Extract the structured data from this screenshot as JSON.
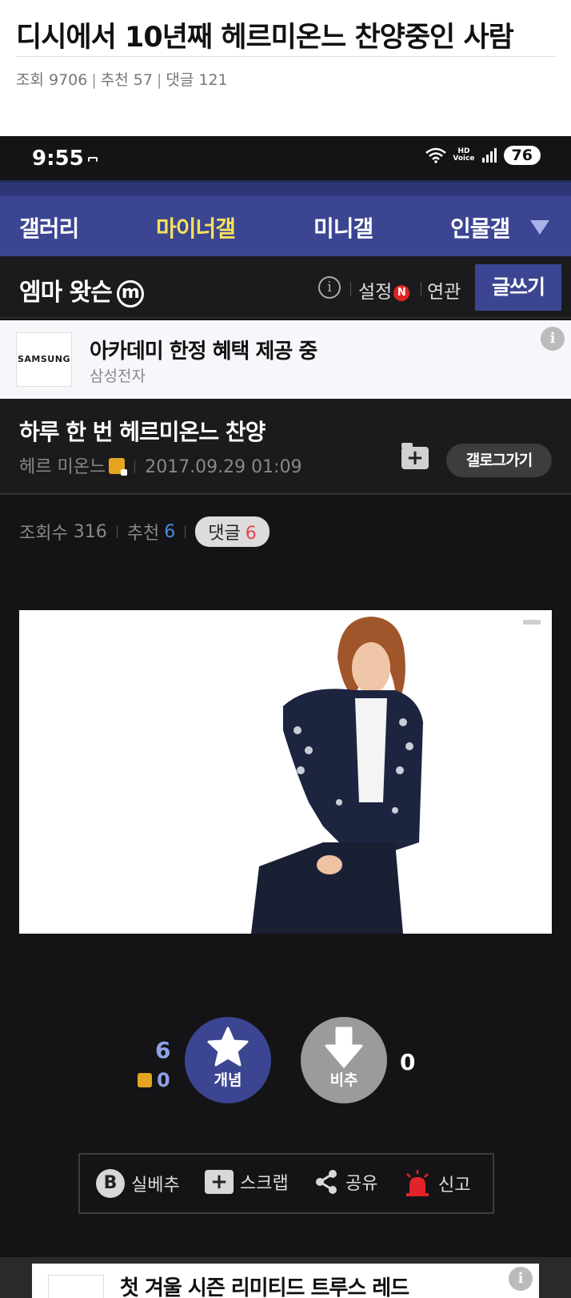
{
  "outer": {
    "title": "디시에서 10년째 헤르미온느 찬양중인 사람",
    "views_label": "조회 9706",
    "likes_label": "추천 57",
    "comments_label": "댓글 121"
  },
  "statusbar": {
    "time": "9:55",
    "network": "HD Voice",
    "battery": "76"
  },
  "gallery_nav": {
    "tabs": [
      {
        "label": "갤러리"
      },
      {
        "label": "마이너갤"
      },
      {
        "label": "미니갤"
      },
      {
        "label": "인물갤"
      }
    ],
    "active_tab": "마이너갤"
  },
  "gallery_head": {
    "name": "엠마 왓슨",
    "badge": "m",
    "settings_label": "설정",
    "new_badge": "N",
    "related_label": "연관",
    "write_label": "글쓰기"
  },
  "ad_top": {
    "brand_logo": "SAMSUNG",
    "title": "아카데미 한정 혜택 제공 중",
    "advertiser": "삼성전자",
    "info_icon": "i"
  },
  "post": {
    "title": "하루 한 번 헤르미온느 찬양",
    "author": "헤르 미온느",
    "datetime": "2017.09.29 01:09",
    "folder_icon": "+",
    "gallery_go_label": "갤로그가기",
    "views_label": "조회수",
    "views_value": "316",
    "recommend_label": "추천",
    "recommend_value": "6",
    "comments_label": "댓글",
    "comments_value": "6"
  },
  "vote": {
    "up_count": "6",
    "fixed_count": "0",
    "up_label": "개념",
    "down_label": "비추",
    "down_count": "0"
  },
  "actions": {
    "b_icon": "B",
    "best_label": "실베추",
    "scrap_icon": "+",
    "scrap_label": "스크랩",
    "share_label": "공유",
    "report_label": "신고"
  },
  "ad_bottom": {
    "title": "첫 겨울 시즌 리미티드 트루스 레드",
    "info_icon": "i"
  },
  "colors": {
    "nav_bg": "#3b4592",
    "active_tab": "#f7e15a",
    "page_bg": "#141416",
    "recommend_blue": "#4d8ae0",
    "comment_red": "#e8474f",
    "report_red": "#e0242a"
  }
}
